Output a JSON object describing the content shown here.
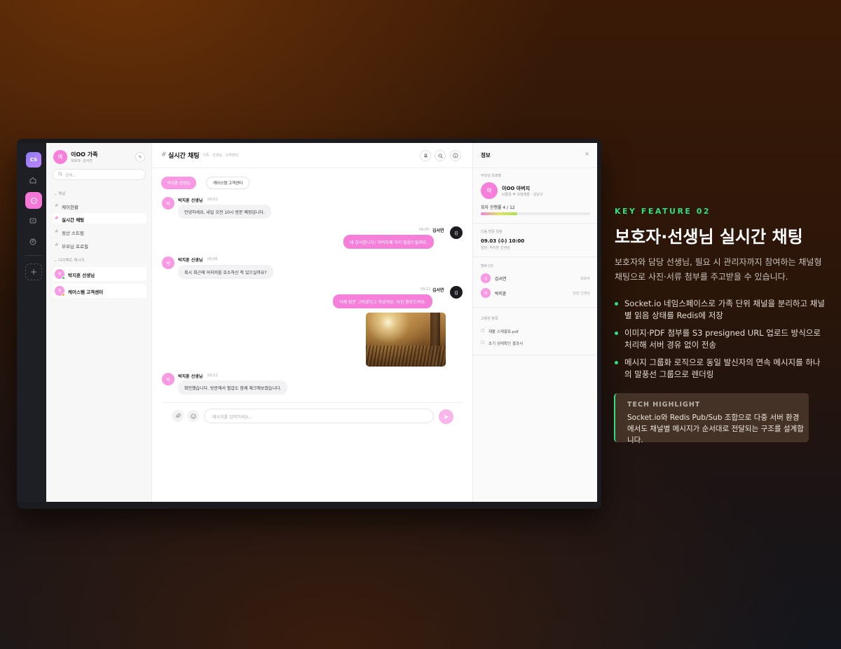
{
  "app": {
    "rail": {
      "logo": "CS",
      "icons": [
        "home-icon",
        "chat-icon",
        "list-icon",
        "profile-icon"
      ],
      "add": "+"
    },
    "workspace": {
      "avatar": "이",
      "name": "이OO 가족",
      "sub": "보호자: 김서연",
      "edit_icon": "✎"
    },
    "search": {
      "placeholder": "검색..."
    },
    "channels": {
      "label": "⌄ 채널",
      "items": [
        {
          "label": "케어현황"
        },
        {
          "label": "실시간 채팅",
          "active": true
        },
        {
          "label": "정산 스트림"
        },
        {
          "label": "부모님 프로필"
        }
      ]
    },
    "dms": {
      "label": "⌄ 다이렉트 메시지",
      "items": [
        {
          "avatar": "박",
          "label": "박지훈 선생님"
        },
        {
          "avatar": "케",
          "label": "케어스템 고객센터"
        }
      ]
    },
    "chat": {
      "title": "실시간 채팅",
      "crumbs": "가족 · 선생님 · 고객센터",
      "chips": [
        "박지훈 선생님",
        "케어스템 고객센터"
      ],
      "messages": [
        {
          "avatar": "박",
          "name": "박지훈 선생님",
          "time": "09:02",
          "text": "안녕하세요, 내일 오전 10시 방문 예정입니다."
        },
        {
          "avatar": "김",
          "name": "김서연",
          "time": "09:05",
          "text": "네 감사합니다! 아버지께 미리 말씀드릴게요."
        },
        {
          "avatar": "박",
          "name": "박지훈 선생님",
          "time": "09:06",
          "text": "혹시 최근에 어지러움 호소하신 적 있으실까요?"
        },
        {
          "avatar": "김",
          "name": "김서연",
          "time": "09:11",
          "text": "어제 잠깐 그러셨다고 하셨어요. 사진 첨부드려요."
        },
        {
          "avatar": "박",
          "name": "박지훈 선생님",
          "time": "09:12",
          "text": "확인했습니다. 방문해서 혈압도 함께 체크해보겠습니다."
        }
      ],
      "composer": {
        "placeholder": "메시지를 입력하세요...",
        "attach": "📎",
        "emoji": "☺",
        "send": "➤"
      }
    },
    "info": {
      "title": "정보",
      "close": "×",
      "profile_label": "부모님 프로필",
      "profile": {
        "avatar": "이",
        "name": "이OO 아버지",
        "sub": "뇌졸중 후 보행재활 · 강남구"
      },
      "progress_text": "회차 진행률 4 / 12",
      "progress": 0.3333,
      "visit_label": "다음 방문 일정",
      "visit": "09.03 (수) 10:00",
      "visit_sub": "담당: 박지훈 선생님",
      "members_label": "멤버 (3)",
      "members": [
        {
          "avatar": "김",
          "name": "김서연",
          "role": "보호자"
        },
        {
          "avatar": "박",
          "name": "박지훈",
          "role": "담당 선생님"
        }
      ],
      "files_label": "고정된 항목",
      "files": [
        "재활 스케줄표.pdf",
        "초기 상태확인 결과서"
      ]
    }
  },
  "copy": {
    "kicker": "KEY FEATURE 02",
    "headline": "보호자·선생님 실시간 채팅",
    "description": "보호자와 담당 선생님, 필요 시 관리자까지 참여하는 채널형 채팅으로 사진·서류 첨부를 주고받을 수 있습니다.",
    "bullets": [
      "Socket.io 네임스페이스로 가족 단위 채널을 분리하고 채널별 읽음 상태를 Redis에 저장",
      "이미지·PDF 첨부를 S3 presigned URL 업로드 방식으로 처리해 서버 경유 없이 전송",
      "메시지 그룹화 로직으로 동일 발신자의 연속 메시지를 하나의 말풍선 그룹으로 렌더링"
    ],
    "tech": {
      "label": "TECH HIGHLIGHT",
      "text": "Socket.io와 Redis Pub/Sub 조합으로 다중 서버 환경에서도 채널별 메시지가 순서대로 전달되는 구조를 설계합니다."
    }
  },
  "colors": {
    "accent": "#f57fd9",
    "green": "#2fe07e",
    "dark": "#1e1f25"
  }
}
